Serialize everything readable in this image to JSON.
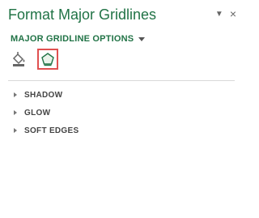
{
  "pane": {
    "title": "Format Major Gridlines",
    "menu_icon": "caret-down-icon",
    "close_icon": "close-icon",
    "close_label": "×",
    "menu_label": "▼"
  },
  "options": {
    "label": "MAJOR GRIDLINE OPTIONS",
    "caret_icon": "chevron-down-icon"
  },
  "tabs": [
    {
      "icon": "fill-line-icon",
      "selected": false
    },
    {
      "icon": "effects-icon",
      "selected": true
    }
  ],
  "sections": [
    {
      "label": "SHADOW",
      "expanded": false
    },
    {
      "label": "GLOW",
      "expanded": false
    },
    {
      "label": "SOFT EDGES",
      "expanded": false
    }
  ],
  "colors": {
    "accent": "#217346",
    "selection_border": "#e05050"
  }
}
